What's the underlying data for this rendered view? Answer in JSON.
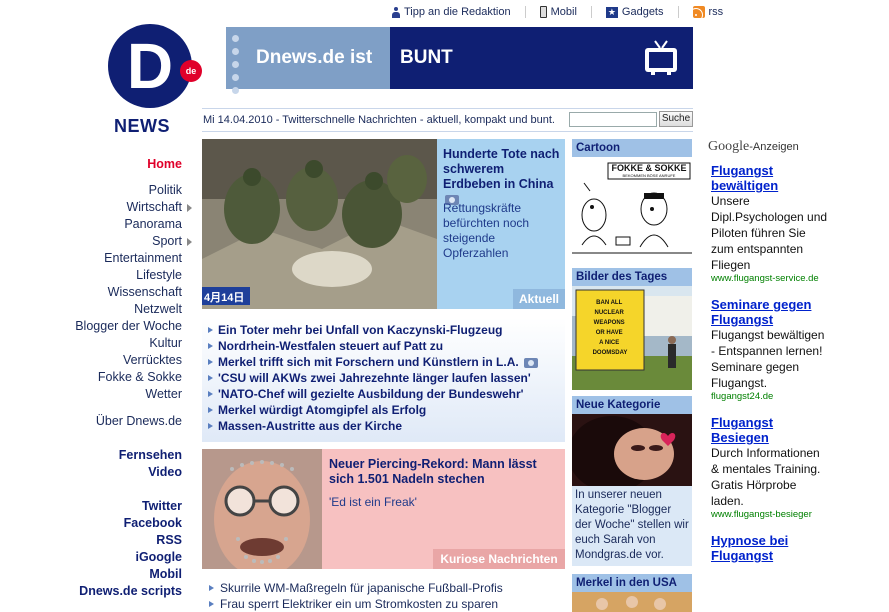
{
  "toplinks": {
    "tipp": "Tipp an die Redaktion",
    "mobil": "Mobil",
    "gadgets": "Gadgets",
    "rss": "rss"
  },
  "logo": {
    "badge": "de",
    "letter": "D",
    "wordmark": "NEWS"
  },
  "banner": {
    "left_text": "Dnews.de ist",
    "right_text": "BUNT",
    "icon": "tv-icon"
  },
  "dateline": {
    "text": "Mi 14.04.2010 - Twitterschnelle Nachrichten - aktuell, kompakt und bunt.",
    "search_value": "",
    "search_button": "Suche"
  },
  "nav": {
    "home": "Home",
    "items": [
      {
        "label": "Politik",
        "submenu": false
      },
      {
        "label": "Wirtschaft",
        "submenu": true
      },
      {
        "label": "Panorama",
        "submenu": false
      },
      {
        "label": "Sport",
        "submenu": true
      },
      {
        "label": "Entertainment",
        "submenu": false
      },
      {
        "label": "Lifestyle",
        "submenu": false
      },
      {
        "label": "Wissenschaft",
        "submenu": false
      },
      {
        "label": "Netzwelt",
        "submenu": false
      },
      {
        "label": "Blogger der Woche",
        "submenu": false
      },
      {
        "label": "Kultur",
        "submenu": false
      },
      {
        "label": "Verrücktes",
        "submenu": false
      },
      {
        "label": "Fokke & Sokke",
        "submenu": false
      },
      {
        "label": "Wetter",
        "submenu": false
      }
    ],
    "ueber": "Über Dnews.de",
    "media": [
      "Fernsehen",
      "Video"
    ],
    "social": [
      "Twitter",
      "Facebook",
      "RSS",
      "iGoogle",
      "Mobil",
      "Dnews.de scripts"
    ]
  },
  "teaser1": {
    "title": "Hunderte Tote nach schwerem Erdbeben in China",
    "desc": "Rettungskräfte befürchten noch steigende Opferzahlen",
    "tag": "Aktuell",
    "photo_caption": "4月14日"
  },
  "newslist": [
    "Ein Toter mehr bei Unfall von Kaczynski-Flugzeug",
    "Nordrhein-Westfalen steuert auf Patt zu",
    "Merkel trifft sich mit Forschern und Künstlern in L.A.",
    "'CSU will AKWs zwei Jahrezehnte länger laufen lassen'",
    "'NATO-Chef will gezielte Ausbildung der Bundeswehr'",
    "Merkel würdigt Atomgipfel als Erfolg",
    "Massen-Austritte aus der Kirche"
  ],
  "teaser2": {
    "title": "Neuer Piercing-Rekord: Mann lässt sich 1.501 Nadeln stechen",
    "desc": "'Ed ist ein Freak'",
    "tag": "Kuriose Nachrichten"
  },
  "morelist": [
    "Skurrile WM-Maßregeln für japanische Fußball-Profis",
    "Frau sperrt Elektriker ein um Stromkosten zu sparen"
  ],
  "right": {
    "cartoon_head": "Cartoon",
    "cartoon_title": "FOKKE & SOKKE",
    "cartoon_sub": "BEKOMMEN BÖSE ANRUFE",
    "bilder_head": "Bilder des Tages",
    "bilder_sign": "BAN ALL NUCLEAR WEAPONS OR HAVE A NICE DOOMSDAY",
    "neue_head": "Neue Kategorie",
    "neue_text": "In unserer neuen Kategorie \"Blogger der Woche\" stellen wir euch Sarah von Mondgras.de vor.",
    "merkel_head": "Merkel in den USA"
  },
  "ads": {
    "google": "Google",
    "label": "-Anzeigen",
    "items": [
      {
        "title": "Flugangst bewältigen",
        "body": "Unsere Dipl.Psychologen und Piloten führen Sie zum entspannten Fliegen",
        "url": "www.flugangst-service.de"
      },
      {
        "title": "Seminare gegen Flugangst",
        "body": "Flugangst bewältigen - Entspannen lernen! Seminare gegen Flugangst.",
        "url": "flugangst24.de"
      },
      {
        "title": "Flugangst Besiegen",
        "body": "Durch Informationen & mentales Training. Gratis Hörprobe laden.",
        "url": "www.flugangst-besieger"
      },
      {
        "title": "Hypnose bei Flugangst",
        "body": "",
        "url": ""
      }
    ]
  },
  "colors": {
    "brand": "#0f1f73",
    "accent": "#e0002a",
    "aktuell_bg": "#a8d2f0",
    "kurios_bg": "#f7c1c1"
  }
}
